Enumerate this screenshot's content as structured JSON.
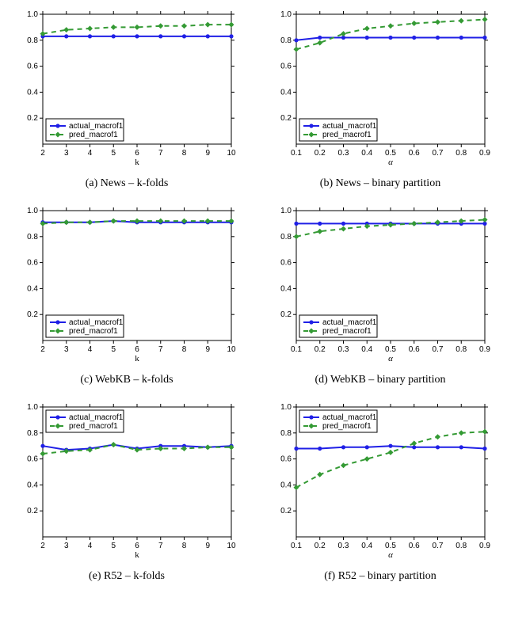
{
  "legend": {
    "actual": "actual_macrof1",
    "pred": "pred_macrof1"
  },
  "captions": {
    "a": "(a) News – k-folds",
    "b": "(b) News – binary partition",
    "c": "(c) WebKB – k-folds",
    "d": "(d) WebKB – binary partition",
    "e": "(e) R52 – k-folds",
    "f": "(f) R52 – binary partition"
  },
  "chart_data": [
    {
      "id": "a",
      "type": "line",
      "xlabel": "k",
      "ylabel": "",
      "x": [
        2,
        3,
        4,
        5,
        6,
        7,
        8,
        9,
        10
      ],
      "ylim": [
        0.0,
        1.0
      ],
      "xlim": [
        2,
        10
      ],
      "yticks": [
        0.2,
        0.4,
        0.6,
        0.8,
        1.0
      ],
      "legend_pos": "lower-left",
      "series": [
        {
          "name": "actual_macrof1",
          "kind": "actual",
          "values": [
            0.83,
            0.83,
            0.83,
            0.83,
            0.83,
            0.83,
            0.83,
            0.83,
            0.83
          ]
        },
        {
          "name": "pred_macrof1",
          "kind": "pred",
          "values": [
            0.85,
            0.88,
            0.89,
            0.9,
            0.9,
            0.91,
            0.91,
            0.92,
            0.92
          ]
        }
      ]
    },
    {
      "id": "b",
      "type": "line",
      "xlabel": "α",
      "ylabel": "",
      "x": [
        0.1,
        0.2,
        0.3,
        0.4,
        0.5,
        0.6,
        0.7,
        0.8,
        0.9
      ],
      "ylim": [
        0.0,
        1.0
      ],
      "xlim": [
        0.1,
        0.9
      ],
      "yticks": [
        0.2,
        0.4,
        0.6,
        0.8,
        1.0
      ],
      "legend_pos": "lower-left",
      "series": [
        {
          "name": "actual_macrof1",
          "kind": "actual",
          "values": [
            0.8,
            0.82,
            0.82,
            0.82,
            0.82,
            0.82,
            0.82,
            0.82,
            0.82
          ]
        },
        {
          "name": "pred_macrof1",
          "kind": "pred",
          "values": [
            0.73,
            0.78,
            0.85,
            0.89,
            0.91,
            0.93,
            0.94,
            0.95,
            0.96
          ]
        }
      ]
    },
    {
      "id": "c",
      "type": "line",
      "xlabel": "k",
      "ylabel": "",
      "x": [
        2,
        3,
        4,
        5,
        6,
        7,
        8,
        9,
        10
      ],
      "ylim": [
        0.0,
        1.0
      ],
      "xlim": [
        2,
        10
      ],
      "yticks": [
        0.2,
        0.4,
        0.6,
        0.8,
        1.0
      ],
      "legend_pos": "lower-left",
      "series": [
        {
          "name": "actual_macrof1",
          "kind": "actual",
          "values": [
            0.91,
            0.91,
            0.91,
            0.92,
            0.91,
            0.91,
            0.91,
            0.91,
            0.91
          ]
        },
        {
          "name": "pred_macrof1",
          "kind": "pred",
          "values": [
            0.9,
            0.91,
            0.91,
            0.92,
            0.92,
            0.92,
            0.92,
            0.92,
            0.92
          ]
        }
      ]
    },
    {
      "id": "d",
      "type": "line",
      "xlabel": "α",
      "ylabel": "",
      "x": [
        0.1,
        0.2,
        0.3,
        0.4,
        0.5,
        0.6,
        0.7,
        0.8,
        0.9
      ],
      "ylim": [
        0.0,
        1.0
      ],
      "xlim": [
        0.1,
        0.9
      ],
      "yticks": [
        0.2,
        0.4,
        0.6,
        0.8,
        1.0
      ],
      "legend_pos": "lower-left",
      "series": [
        {
          "name": "actual_macrof1",
          "kind": "actual",
          "values": [
            0.9,
            0.9,
            0.9,
            0.9,
            0.9,
            0.9,
            0.9,
            0.9,
            0.9
          ]
        },
        {
          "name": "pred_macrof1",
          "kind": "pred",
          "values": [
            0.8,
            0.84,
            0.86,
            0.88,
            0.89,
            0.9,
            0.91,
            0.92,
            0.93
          ]
        }
      ]
    },
    {
      "id": "e",
      "type": "line",
      "xlabel": "k",
      "ylabel": "",
      "x": [
        2,
        3,
        4,
        5,
        6,
        7,
        8,
        9,
        10
      ],
      "ylim": [
        0.0,
        1.0
      ],
      "xlim": [
        2,
        10
      ],
      "yticks": [
        0.2,
        0.4,
        0.6,
        0.8,
        1.0
      ],
      "legend_pos": "upper-left",
      "series": [
        {
          "name": "actual_macrof1",
          "kind": "actual",
          "values": [
            0.7,
            0.67,
            0.68,
            0.71,
            0.68,
            0.7,
            0.7,
            0.69,
            0.7
          ]
        },
        {
          "name": "pred_macrof1",
          "kind": "pred",
          "values": [
            0.64,
            0.66,
            0.67,
            0.71,
            0.67,
            0.68,
            0.68,
            0.69,
            0.69
          ]
        }
      ]
    },
    {
      "id": "f",
      "type": "line",
      "xlabel": "α",
      "ylabel": "",
      "x": [
        0.1,
        0.2,
        0.3,
        0.4,
        0.5,
        0.6,
        0.7,
        0.8,
        0.9
      ],
      "ylim": [
        0.0,
        1.0
      ],
      "xlim": [
        0.1,
        0.9
      ],
      "yticks": [
        0.2,
        0.4,
        0.6,
        0.8,
        1.0
      ],
      "legend_pos": "upper-left",
      "series": [
        {
          "name": "actual_macrof1",
          "kind": "actual",
          "values": [
            0.68,
            0.68,
            0.69,
            0.69,
            0.7,
            0.69,
            0.69,
            0.69,
            0.68
          ]
        },
        {
          "name": "pred_macrof1",
          "kind": "pred",
          "values": [
            0.38,
            0.48,
            0.55,
            0.6,
            0.65,
            0.72,
            0.77,
            0.8,
            0.81
          ]
        }
      ]
    }
  ]
}
